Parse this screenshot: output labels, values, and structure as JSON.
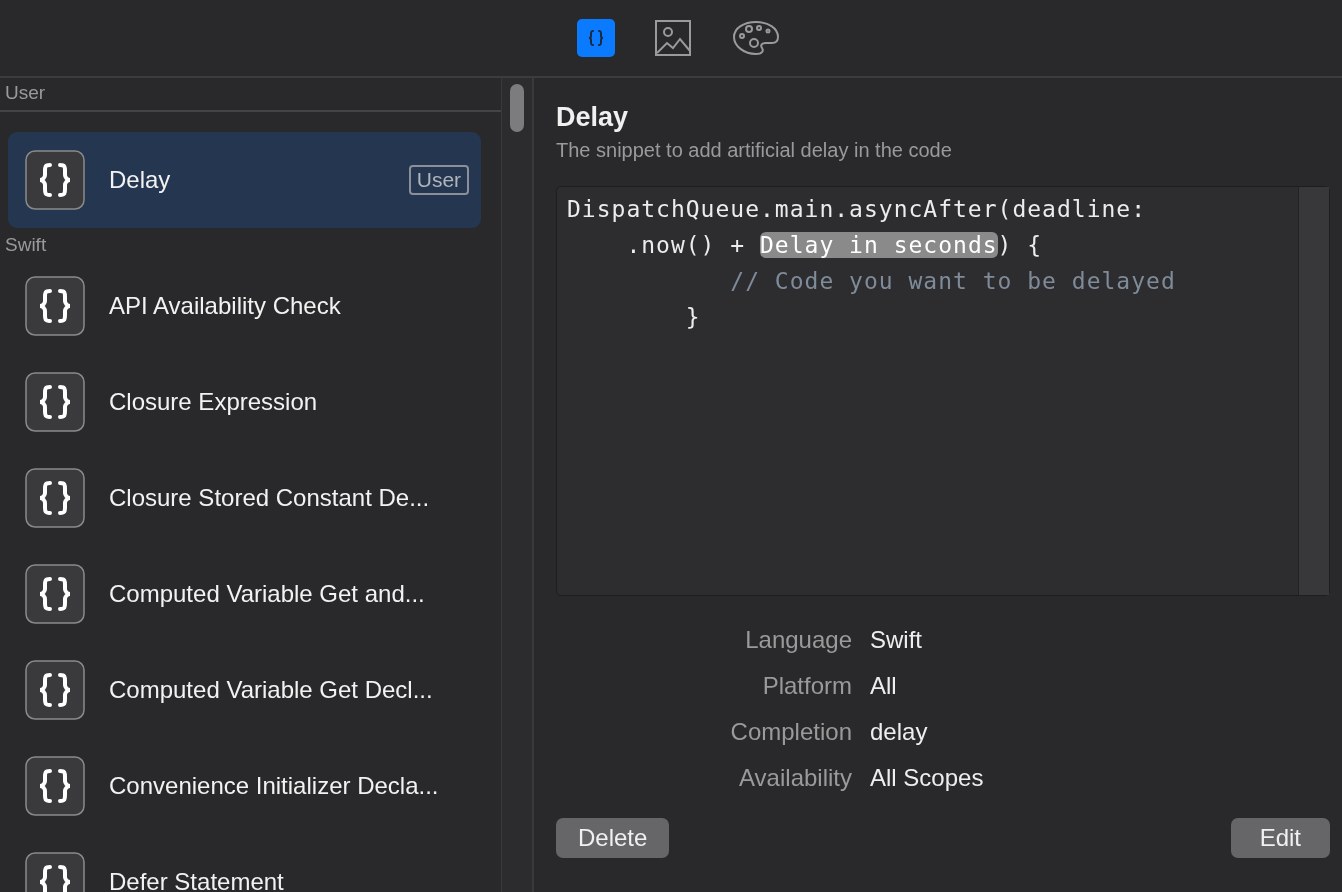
{
  "toolbar": {
    "tabs": [
      {
        "kind": "snippets",
        "selected": true
      },
      {
        "kind": "media",
        "selected": false
      },
      {
        "kind": "colors",
        "selected": false
      }
    ]
  },
  "sidebar": {
    "sections": [
      {
        "title": "User",
        "items": [
          {
            "name": "Delay",
            "badge": "User",
            "selected": true
          }
        ]
      },
      {
        "title": "Swift",
        "items": [
          {
            "name": "API Availability Check",
            "selected": false
          },
          {
            "name": "Closure Expression",
            "selected": false
          },
          {
            "name": "Closure Stored Constant De...",
            "selected": false
          },
          {
            "name": "Computed Variable Get and...",
            "selected": false
          },
          {
            "name": "Computed Variable Get Decl...",
            "selected": false
          },
          {
            "name": "Convenience Initializer Decla...",
            "selected": false
          },
          {
            "name": "Defer Statement",
            "selected": false
          }
        ]
      }
    ]
  },
  "detail": {
    "title": "Delay",
    "subtitle": "The snippet to add artificial delay in the code",
    "code": [
      [
        {
          "kind": "text",
          "text": "DispatchQueue.main.asyncAfter(deadline:"
        }
      ],
      [
        {
          "kind": "text",
          "text": "    .now() + "
        },
        {
          "kind": "placeholder",
          "text": "Delay in seconds"
        },
        {
          "kind": "text",
          "text": ") {"
        }
      ],
      [
        {
          "kind": "comment",
          "text": "           // Code you want to be delayed"
        }
      ],
      [
        {
          "kind": "text",
          "text": "        }"
        }
      ]
    ],
    "properties": [
      {
        "label": "Language",
        "value": "Swift"
      },
      {
        "label": "Platform",
        "value": "All"
      },
      {
        "label": "Completion",
        "value": "delay"
      },
      {
        "label": "Availability",
        "value": "All Scopes"
      }
    ],
    "buttons": {
      "delete": "Delete",
      "edit": "Edit"
    }
  }
}
